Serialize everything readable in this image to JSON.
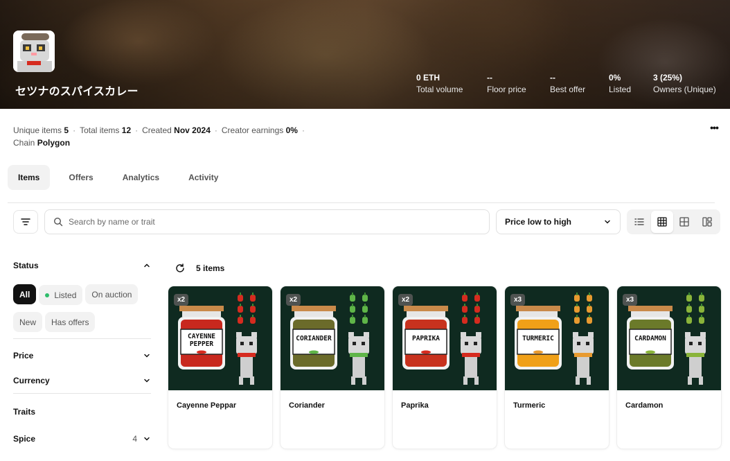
{
  "collection": {
    "name": "セツナのスパイスカレー",
    "stats": [
      {
        "value": "0 ETH",
        "label": "Total volume"
      },
      {
        "value": "--",
        "label": "Floor price"
      },
      {
        "value": "--",
        "label": "Best offer"
      },
      {
        "value": "0%",
        "label": "Listed"
      },
      {
        "value": "3 (25%)",
        "label": "Owners (Unique)"
      }
    ],
    "meta": {
      "unique_items_label": "Unique items",
      "unique_items": "5",
      "total_items_label": "Total items",
      "total_items": "12",
      "created_label": "Created",
      "created": "Nov 2024",
      "creator_earnings_label": "Creator earnings",
      "creator_earnings": "0%",
      "chain_label": "Chain",
      "chain": "Polygon"
    },
    "more_icon": "more-horizontal-icon"
  },
  "tabs": [
    {
      "label": "Items",
      "active": true
    },
    {
      "label": "Offers",
      "active": false
    },
    {
      "label": "Analytics",
      "active": false
    },
    {
      "label": "Activity",
      "active": false
    }
  ],
  "toolbar": {
    "search_placeholder": "Search by name or trait",
    "sort_value": "Price low to high",
    "view_modes": [
      "list-view-icon",
      "grid-small-icon",
      "grid-large-icon",
      "masonry-icon"
    ],
    "active_view": 1
  },
  "sidebar": {
    "status_title": "Status",
    "status_options": [
      {
        "label": "All",
        "active": true
      },
      {
        "label": "Listed",
        "active": false
      },
      {
        "label": "On auction",
        "active": false
      },
      {
        "label": "New",
        "active": false
      },
      {
        "label": "Has offers",
        "active": false
      }
    ],
    "price_title": "Price",
    "currency_title": "Currency",
    "traits_title": "Traits",
    "spice_title": "Spice",
    "spice_count": "4"
  },
  "grid": {
    "count_label": "5 items",
    "items": [
      {
        "name": "Cayenne Peppar",
        "qty": "x2",
        "jar_label": "CAYENNE PEPPER",
        "jar_color": "#c8281e",
        "accent": "#d62b1f"
      },
      {
        "name": "Coriander",
        "qty": "x2",
        "jar_label": "CORIANDER",
        "jar_color": "#6b6b2a",
        "accent": "#5fb548"
      },
      {
        "name": "Paprika",
        "qty": "x2",
        "jar_label": "PAPRIKA",
        "jar_color": "#c8321e",
        "accent": "#d62b1f"
      },
      {
        "name": "Turmeric",
        "qty": "x3",
        "jar_label": "TURMERIC",
        "jar_color": "#f0a018",
        "accent": "#e89a30"
      },
      {
        "name": "Cardamon",
        "qty": "x3",
        "jar_label": "CARDAMON",
        "jar_color": "#6b7a2a",
        "accent": "#8ab43a"
      }
    ]
  },
  "colors": {
    "accent_dark": "#121212",
    "listed_dot": "#2ebd6b",
    "card_bg": "#0f2a20"
  }
}
